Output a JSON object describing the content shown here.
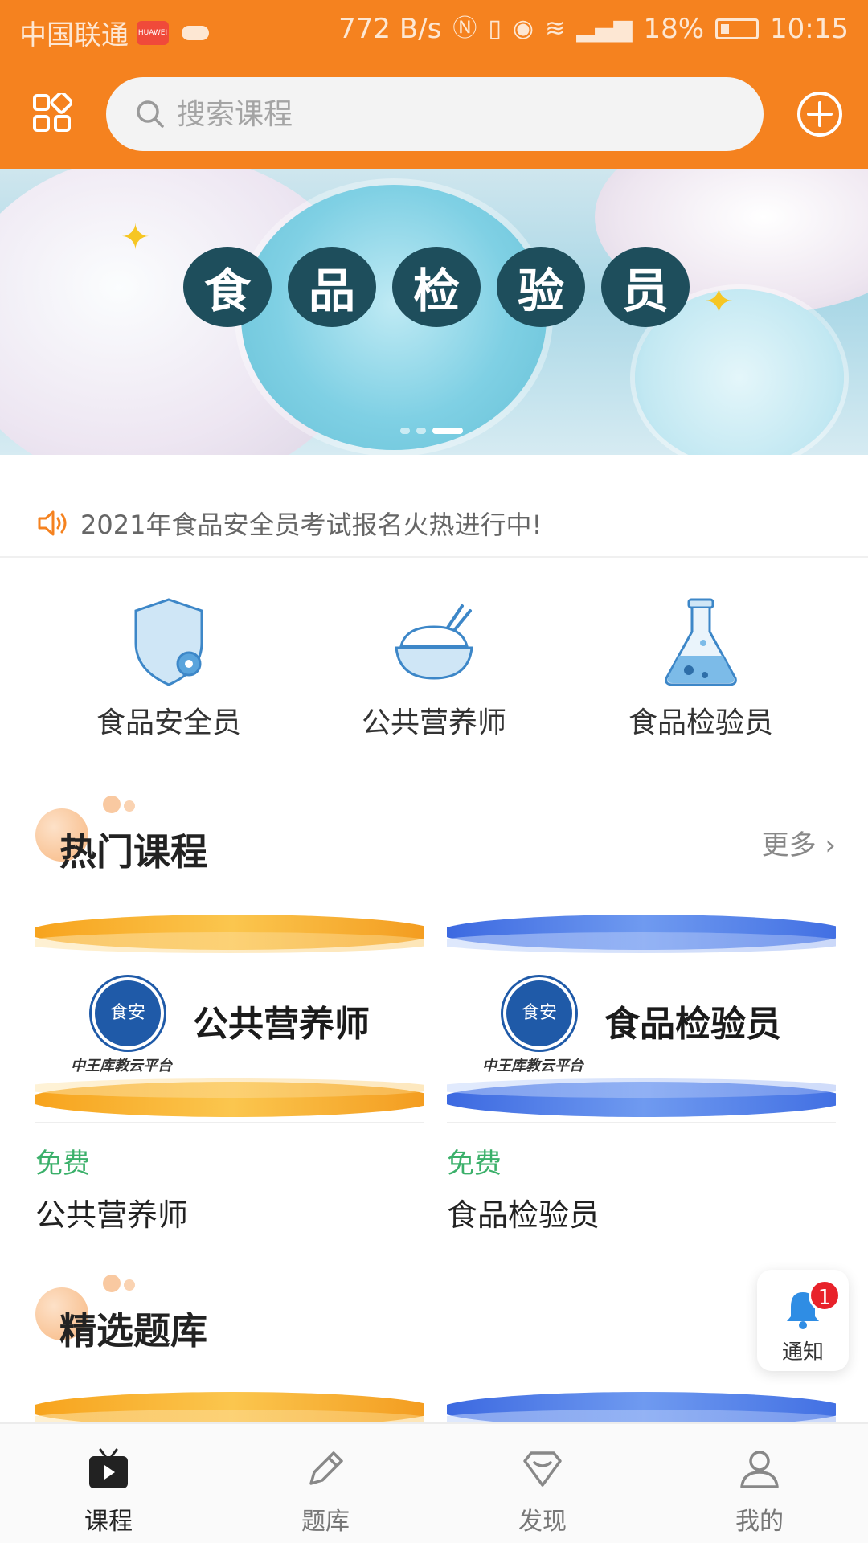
{
  "status_bar": {
    "carrier": "中国联通",
    "huawei_badge": "HUAWEI",
    "speed": "772 B/s",
    "battery": "18%",
    "time": "10:15"
  },
  "header": {
    "search_placeholder": "搜索课程"
  },
  "banner": {
    "chars": [
      "食",
      "品",
      "检",
      "验",
      "员"
    ],
    "slides": 3,
    "active_slide": 3
  },
  "notice": {
    "text": "2021年食品安全员考试报名火热进行中!"
  },
  "categories": [
    {
      "label": "食品安全员",
      "icon": "shield-gear-icon"
    },
    {
      "label": "公共营养师",
      "icon": "rice-bowl-icon"
    },
    {
      "label": "食品检验员",
      "icon": "flask-icon"
    }
  ],
  "hot_courses": {
    "title": "热门课程",
    "more": "更多",
    "items": [
      {
        "thumb_title": "公共营养师",
        "platform": "中王库教云平台",
        "logo": "食安",
        "price": "免费",
        "name": "公共营养师",
        "theme": "orange"
      },
      {
        "thumb_title": "食品检验员",
        "platform": "中王库教云平台",
        "logo": "食安",
        "price": "免费",
        "name": "食品检验员",
        "theme": "blue"
      }
    ]
  },
  "question_bank": {
    "title": "精选题库"
  },
  "notify": {
    "label": "通知",
    "count": "1"
  },
  "tabs": [
    {
      "label": "课程",
      "icon": "tv-play-icon",
      "active": true
    },
    {
      "label": "题库",
      "icon": "pencil-icon",
      "active": false
    },
    {
      "label": "发现",
      "icon": "diamond-icon",
      "active": false
    },
    {
      "label": "我的",
      "icon": "user-icon",
      "active": false
    }
  ],
  "colors": {
    "brand_orange": "#f5821f",
    "price_green": "#3bb06a",
    "badge_red": "#e8222a"
  }
}
